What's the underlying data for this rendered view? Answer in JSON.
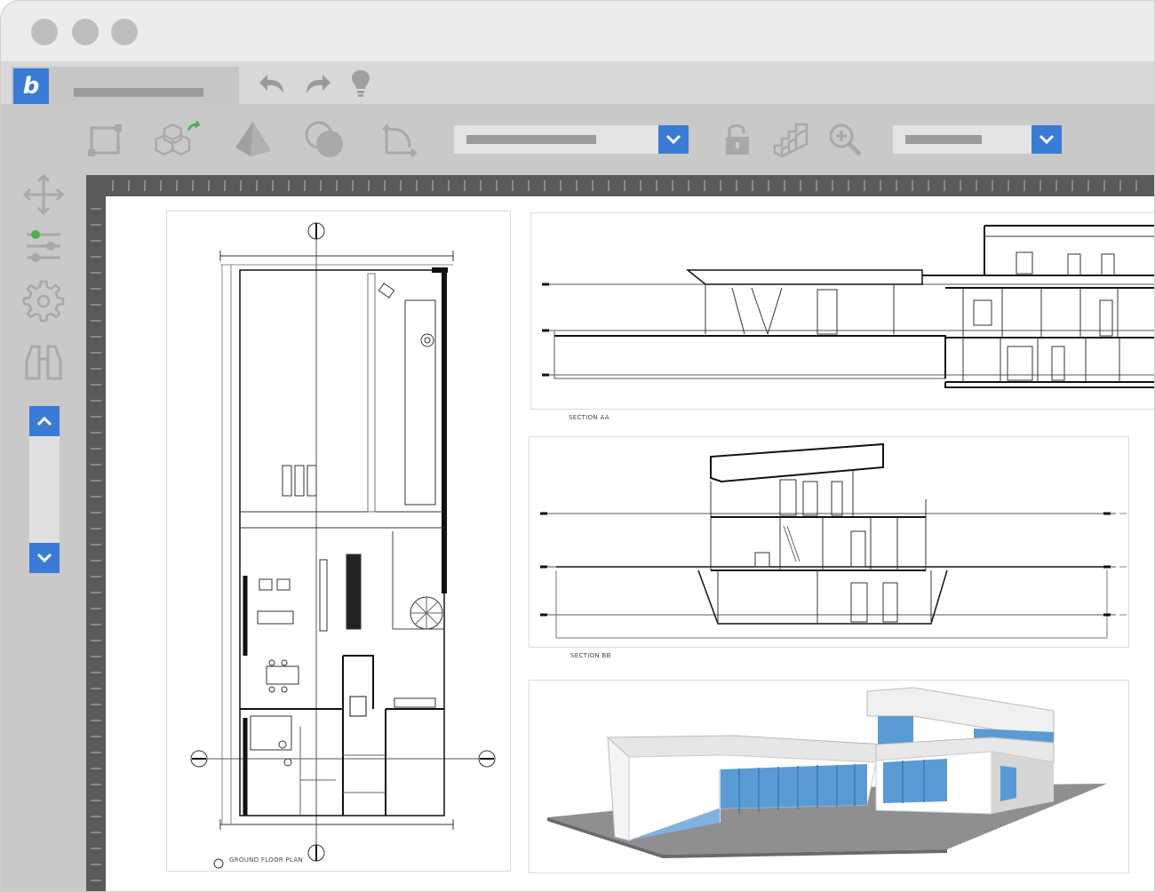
{
  "window": {
    "traffic_lights": [
      "close",
      "minimize",
      "maximize"
    ]
  },
  "tab": {
    "app_logo_glyph": "b",
    "title_text": ""
  },
  "quick_access": {
    "icons": [
      "undo-icon",
      "redo-icon",
      "lightbulb-icon"
    ]
  },
  "toolbar": {
    "icons": [
      "rectangle-tool-icon",
      "blocks-export-icon",
      "pyramid-icon",
      "union-shapes-icon",
      "rotate-3d-icon",
      "lock-icon",
      "stairs-icon",
      "zoom-in-icon"
    ],
    "layer_select_value": "",
    "view_select_value": ""
  },
  "sidebar": {
    "icons": [
      "move-icon",
      "sliders-icon",
      "gear-icon",
      "binoculars-icon"
    ],
    "scroll_icons": [
      "chevron-up-icon",
      "chevron-down-icon"
    ]
  },
  "drawings": {
    "plan_label": "GROUND FLOOR PLAN",
    "section_a_label": "SECTION AA",
    "section_b_label": "SECTION BB"
  },
  "colors": {
    "accent": "#3a7bd5",
    "status_green": "#4caf50",
    "glass": "#5b9bd5"
  }
}
